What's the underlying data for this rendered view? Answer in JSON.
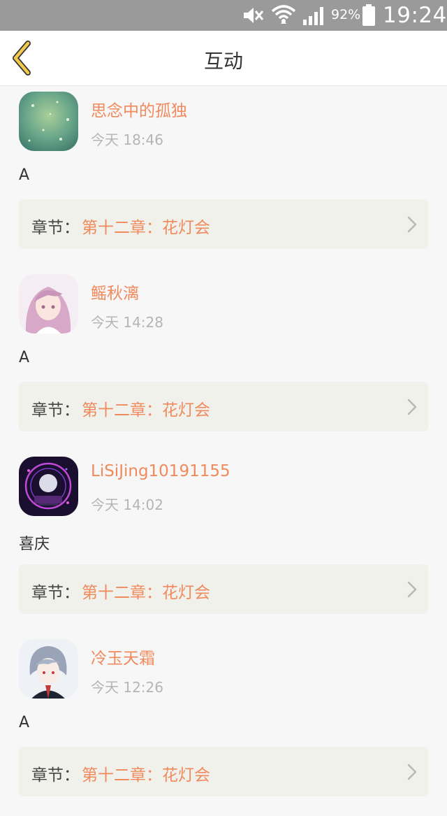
{
  "status_bar": {
    "battery_percent": "92%",
    "time": "19:24",
    "icons": [
      "mute-icon",
      "wifi-icon",
      "signal-icon",
      "battery-icon"
    ]
  },
  "header": {
    "back_icon": "chevron-left-icon",
    "title": "互动"
  },
  "feed": {
    "items": [
      {
        "username": "思念中的孤独",
        "time": "今天 18:46",
        "comment": "A",
        "chapter_prefix": "章节：",
        "chapter_title": "第十二章：花灯会"
      },
      {
        "username": "鳐秋漓",
        "time": "今天 14:28",
        "comment": "A",
        "chapter_prefix": "章节：",
        "chapter_title": "第十二章：花灯会"
      },
      {
        "username": "LiSiJing10191155",
        "time": "今天 14:02",
        "comment": "喜庆",
        "chapter_prefix": "章节：",
        "chapter_title": "第十二章：花灯会"
      },
      {
        "username": "冷玉天霜",
        "time": "今天 12:26",
        "comment": "A",
        "chapter_prefix": "章节：",
        "chapter_title": "第十二章：花灯会"
      }
    ]
  },
  "colors": {
    "accent": "#f08a5d",
    "back_icon": "#f2c94c",
    "status_bar": "#9a9a9a",
    "card_bg": "#f1f1ec"
  }
}
